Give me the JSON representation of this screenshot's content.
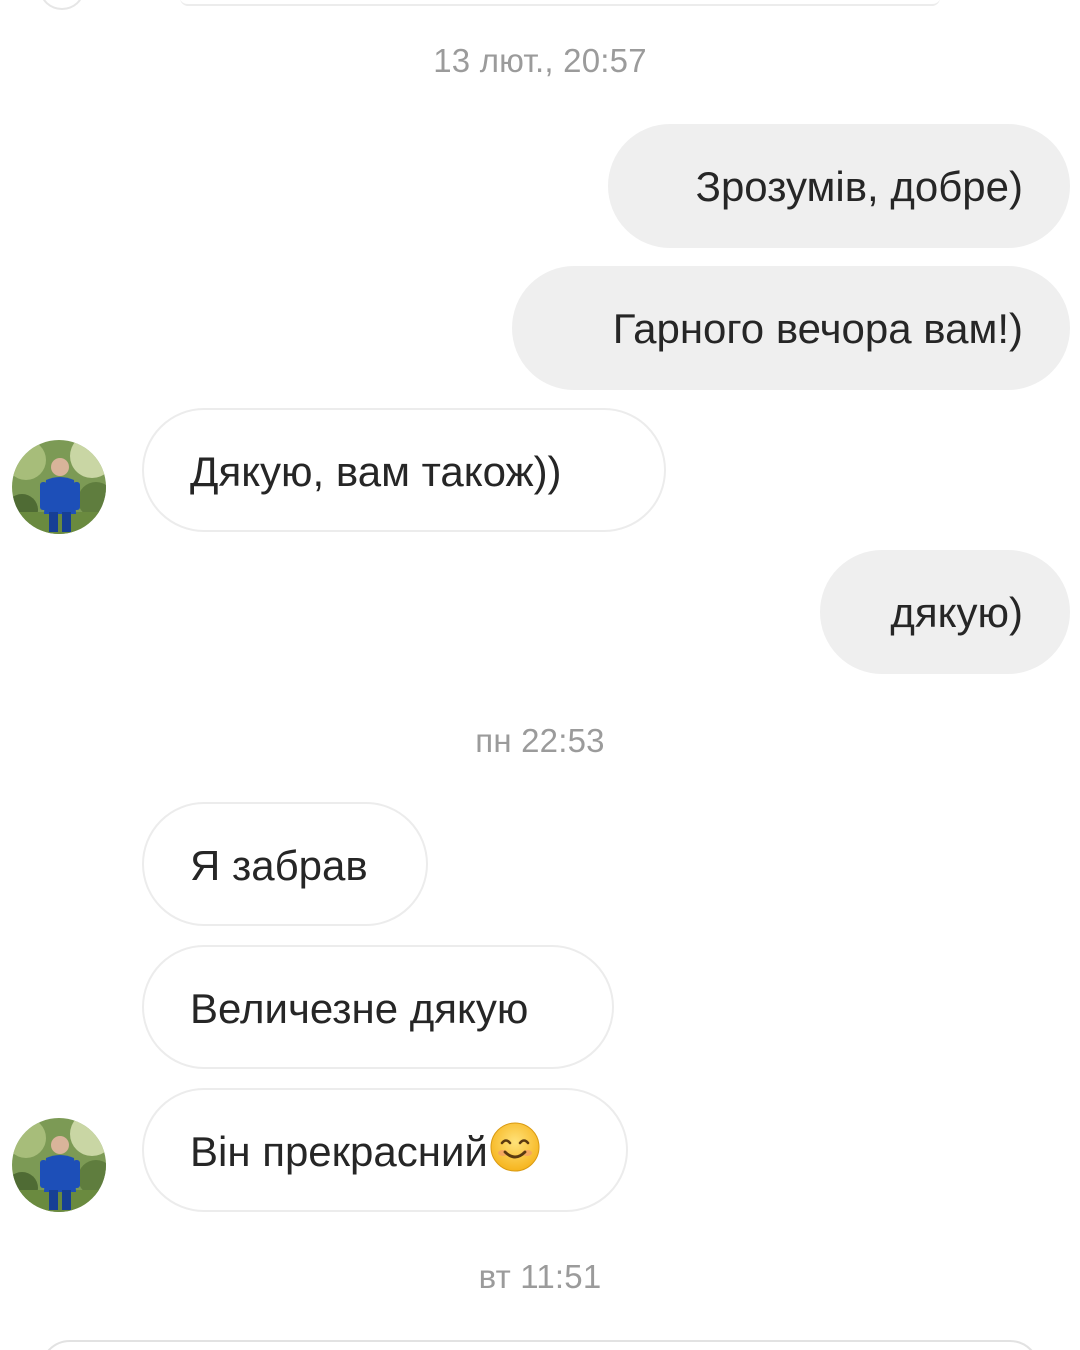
{
  "timestamps": {
    "t1": "13 лют., 20:57",
    "t2": "пн 22:53",
    "t3": "вт 11:51"
  },
  "messages": {
    "m1": {
      "direction": "outgoing",
      "text": "Зрозумів, добре)"
    },
    "m2": {
      "direction": "outgoing",
      "text": "Гарного вечора вам!)"
    },
    "m3": {
      "direction": "incoming",
      "text": "Дякую, вам також))"
    },
    "m4": {
      "direction": "outgoing",
      "text": "дякую)"
    },
    "m5": {
      "direction": "incoming",
      "text": "Я забрав"
    },
    "m6": {
      "direction": "incoming",
      "text": "Величезне дякую"
    },
    "m7": {
      "direction": "incoming",
      "text": "Він прекрасний",
      "emoji": "smiling-face-emoji"
    }
  },
  "avatars": {
    "sender": {
      "icon": "profile-photo-avatar"
    }
  },
  "colors": {
    "outgoing_bubble": "#efefef",
    "incoming_bubble_border": "#ececec",
    "timestamp_text": "#9b9b9b",
    "message_text": "#262626"
  }
}
